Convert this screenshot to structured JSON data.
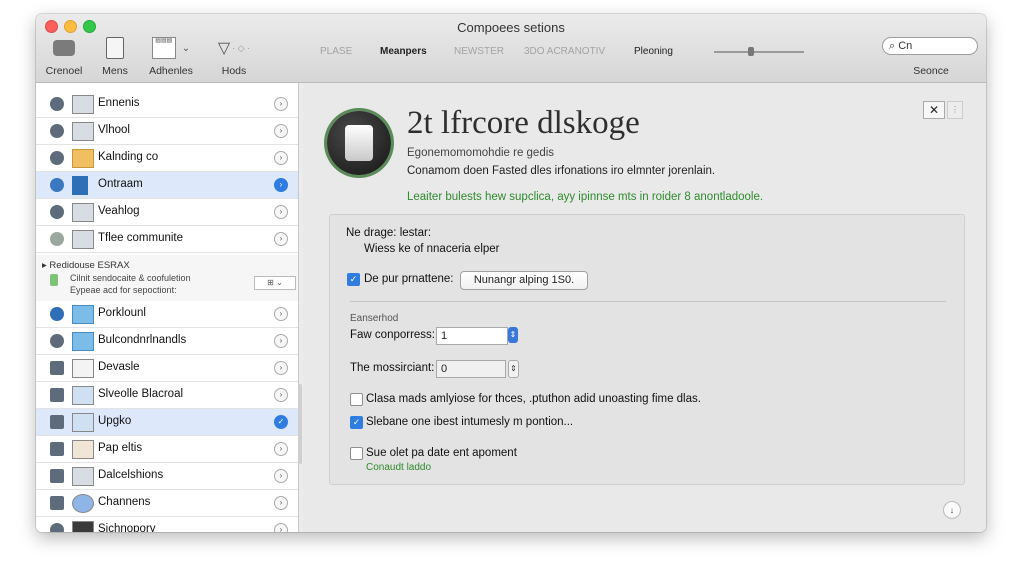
{
  "window": {
    "title": "Compoees setions"
  },
  "toolbar": {
    "items": [
      {
        "label": "Crenoel",
        "icon": "cancel-icon"
      },
      {
        "label": "Mens",
        "icon": "document-icon"
      },
      {
        "label": "Adhenles",
        "icon": "address-icon"
      },
      {
        "label": "Hods",
        "icon": "filter-icon"
      }
    ],
    "segments": [
      "PLASE",
      "Meanpers",
      "NEWSTER",
      "3DO ACRANOTIV"
    ],
    "active_segment": "Meanpers",
    "slider_label": "Pleoning",
    "search_value": "Cn",
    "search_label": "Seonce"
  },
  "sidebar": {
    "items": [
      {
        "label": "Ennenis",
        "selected": false
      },
      {
        "label": "Vlhool",
        "selected": false
      },
      {
        "label": "Kalnding co",
        "selected": false
      },
      {
        "label": "Ontraam",
        "selected": true
      },
      {
        "label": "Veahlog",
        "selected": false
      },
      {
        "label": "Tflee communite",
        "selected": false
      }
    ],
    "group": {
      "header": "Redidouse ESRAX",
      "line1": "Cilnit sendocaite & coofuletion",
      "line2": "Eypeae acd for sepoctiont:"
    },
    "items2": [
      {
        "label": "Porklounl",
        "selected": false
      },
      {
        "label": "Bulcondnrlnandls",
        "selected": false
      },
      {
        "label": "Devasle",
        "selected": false
      },
      {
        "label": "Slveolle Blacroal",
        "selected": false
      },
      {
        "label": "Upgko",
        "selected": true
      },
      {
        "label": "Pap eltis",
        "selected": false
      },
      {
        "label": "Dalcelshions",
        "selected": false
      },
      {
        "label": "Channens",
        "selected": false
      },
      {
        "label": "Sichnopory",
        "selected": false
      }
    ]
  },
  "content": {
    "title": "2t lfrcore dlskoge",
    "subtitle": "Egonemomomohdie re gedis",
    "description": "Conamom doen Fasted dles irfonations iro elmnter jorenlain.",
    "green_note": "Leaiter bulests hew supclica, ayy ipinnse mts in roider 8 anontladoole.",
    "panel": {
      "heading": "Ne drage: lestar:",
      "subheading": "Wiess ke of nnaceria elper",
      "check1_label": "De pur prnattene:",
      "check1_checked": true,
      "check1_button": "Nunangr alping 1S0.",
      "section_label": "Eanserhod",
      "field1_label": "Faw conporress:",
      "field1_value": "1",
      "field2_label": "The mossirciant:",
      "field2_value": "0",
      "check2_label": "Clasa mads amlyiose for thces, .ptuthon adid unoasting fime dlas.",
      "check2_checked": false,
      "check3_label": "Slebane one ibest intumesly m pontion...",
      "check3_checked": true,
      "check4_label": "Sue olet pa date ent apoment",
      "check4_checked": false,
      "check4_note": "Conaudt laddo"
    }
  }
}
